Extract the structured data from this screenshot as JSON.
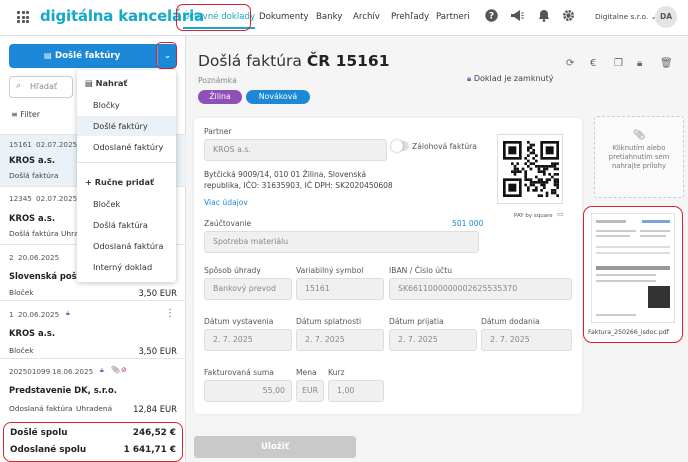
{
  "header": {
    "brand": "digitálna kancelária",
    "nav": [
      "Účtovné doklady",
      "Dokumenty",
      "Banky",
      "Archív",
      "Prehľady",
      "Partneri"
    ],
    "company": "Digitalne s.r.o.",
    "avatar": "DA",
    "icons": [
      "help-icon",
      "megaphone-icon",
      "bell-icon",
      "gear-icon"
    ]
  },
  "left": {
    "new_button": "Došlé faktúry",
    "search_placeholder": "Hľadať",
    "filter": "Filter",
    "items": [
      {
        "no": "15161",
        "date": "02.07.2025",
        "partner": "KROS a.s.",
        "type": "Došlá faktúra",
        "status": "",
        "amount": ""
      },
      {
        "no": "12345",
        "date": "02.07.2025",
        "partner": "KROS a.s.",
        "type": "Došlá faktúra",
        "status": "Uhra",
        "amount": ""
      },
      {
        "no": "2",
        "date": "20.06.2025",
        "partner": "Slovenská pošta, a.s.",
        "type": "Bloček",
        "status": "",
        "amount": "3,50 EUR"
      },
      {
        "no": "1",
        "date": "20.06.2025",
        "partner": "KROS a.s.",
        "type": "Bloček",
        "status": "",
        "amount": "3,50 EUR"
      },
      {
        "no": "202501099",
        "date": "18.06.2025",
        "partner": "Predstavenie DK, s.r.o.",
        "type": "Odoslaná faktúra",
        "status": "Uhradená",
        "amount": "12,84 EUR"
      }
    ],
    "totals": {
      "incoming_label": "Došlé spolu",
      "incoming": "246,52 €",
      "outgoing_label": "Odoslané spolu",
      "outgoing": "1 641,71 €"
    }
  },
  "menu": {
    "import_header": "Nahrať",
    "import_items": [
      "Bločky",
      "Došlé faktúry",
      "Odoslané faktúry"
    ],
    "manual_header": "+ Ručne pridať",
    "manual_items": [
      "Bloček",
      "Došlá faktúra",
      "Odoslaná faktúra",
      "Interný doklad"
    ]
  },
  "document": {
    "title_prefix": "Došlá faktúra",
    "title_number": "ČR 15161",
    "note_label": "Poznámka",
    "locked": "Doklad je zamknutý",
    "tags": [
      "Žilina",
      "Nováková"
    ],
    "tag_colors": [
      "#8e4fb8",
      "#1d88d8"
    ],
    "partner_label": "Partner",
    "partner": "KROS a.s.",
    "advance_invoice": "Zálohová faktúra",
    "address": "Bytčická 9009/14, 010 01 Žilina, Slovenská republika, IČO: 31635903, IČ DPH: SK2020450608",
    "more": "Viac údajov",
    "pay_by_square": "PAY by square",
    "posting_label": "Zaúčtovanie",
    "posting_amount": "501 000",
    "posting_value": "Spotreba materiálu",
    "payment_method_label": "Spôsob úhrady",
    "payment_method": "Bankový prevod",
    "var_symbol_label": "Variabilný symbol",
    "var_symbol": "15161",
    "iban_label": "IBAN / Číslo účtu",
    "iban": "SK6611000000002625535370",
    "issued_label": "Dátum vystavenia",
    "issued": "2. 7. 2025",
    "due_label": "Dátum splatnosti",
    "due": "2. 7. 2025",
    "received_label": "Dátum prijatia",
    "received": "2. 7. 2025",
    "delivered_label": "Dátum dodania",
    "delivered": "2. 7. 2025",
    "amount_label": "Fakturovaná suma",
    "amount": "55,00",
    "currency_label": "Mena",
    "currency": "EUR",
    "rate_label": "Kurz",
    "rate": "1,00",
    "save": "Uložiť"
  },
  "attachments": {
    "drop_text": "Kliknutím alebo pretiahnutím sem nahrajte prílohy",
    "file_name": "Faktura_250266_isdoc.pdf"
  }
}
